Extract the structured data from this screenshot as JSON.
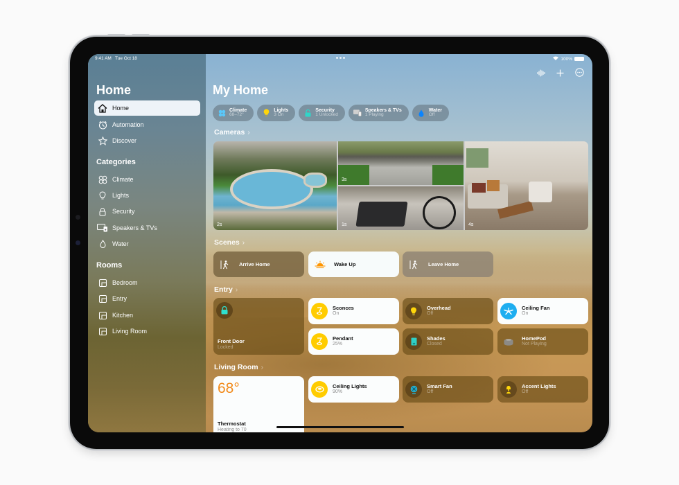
{
  "status_bar": {
    "time": "9:41 AM",
    "date": "Tue Oct 18",
    "battery": "100%"
  },
  "sidebar": {
    "title": "Home",
    "items": [
      {
        "label": "Home",
        "icon": "house-icon",
        "active": true
      },
      {
        "label": "Automation",
        "icon": "clock-icon"
      },
      {
        "label": "Discover",
        "icon": "star-icon"
      }
    ],
    "categories_title": "Categories",
    "categories": [
      {
        "label": "Climate",
        "icon": "fan-icon"
      },
      {
        "label": "Lights",
        "icon": "lightbulb-icon"
      },
      {
        "label": "Security",
        "icon": "lock-icon"
      },
      {
        "label": "Speakers & TVs",
        "icon": "tv-speaker-icon"
      },
      {
        "label": "Water",
        "icon": "drop-icon"
      }
    ],
    "rooms_title": "Rooms",
    "rooms": [
      {
        "label": "Bedroom",
        "icon": "room-icon"
      },
      {
        "label": "Entry",
        "icon": "room-icon"
      },
      {
        "label": "Kitchen",
        "icon": "room-icon"
      },
      {
        "label": "Living Room",
        "icon": "room-icon"
      }
    ]
  },
  "main": {
    "title": "My Home",
    "toolbar": [
      "waveform-icon",
      "plus-icon",
      "more-icon"
    ],
    "chips": [
      {
        "label": "Climate",
        "sub": "68–72°",
        "icon": "fan-icon",
        "color": "#5ac8fa"
      },
      {
        "label": "Lights",
        "sub": "3 On",
        "icon": "lightbulb-icon",
        "color": "#ffd60a"
      },
      {
        "label": "Security",
        "sub": "1 Unlocked",
        "icon": "lock-icon",
        "color": "#30d5c8"
      },
      {
        "label": "Speakers & TVs",
        "sub": "1 Playing",
        "icon": "tv-speaker-icon",
        "color": "#d8d8d8"
      },
      {
        "label": "Water",
        "sub": "Off",
        "icon": "drop-icon",
        "color": "#0a84ff"
      }
    ],
    "cameras": {
      "title": "Cameras",
      "feeds": [
        {
          "label": "2s",
          "name": "pool"
        },
        {
          "label": "3s",
          "name": "driveway"
        },
        {
          "label": "1s",
          "name": "garage"
        },
        {
          "label": "4s",
          "name": "living-room"
        }
      ]
    },
    "scenes": {
      "title": "Scenes",
      "items": [
        {
          "label": "Arrive Home",
          "icon": "person-arrive-icon",
          "active": false
        },
        {
          "label": "Wake Up",
          "icon": "sunrise-icon",
          "active": true
        },
        {
          "label": "Leave Home",
          "icon": "person-leave-icon",
          "active": false
        }
      ]
    },
    "entry": {
      "title": "Entry",
      "front_door": {
        "name": "Front Door",
        "state": "Locked"
      },
      "tiles": [
        {
          "name": "Sconces",
          "state": "On",
          "active": true
        },
        {
          "name": "Overhead",
          "state": "Off",
          "active": false
        },
        {
          "name": "Ceiling Fan",
          "state": "On",
          "active": true
        },
        {
          "name": "Pendant",
          "state": "25%",
          "active": true
        },
        {
          "name": "Shades",
          "state": "Closed",
          "active": false
        },
        {
          "name": "HomePod",
          "state": "Not Playing",
          "active": false
        }
      ]
    },
    "living_room": {
      "title": "Living Room",
      "thermostat": {
        "temp": "68°",
        "name": "Thermostat",
        "state": "Heating to 70"
      },
      "tiles": [
        {
          "name": "Ceiling Lights",
          "state": "90%",
          "active": true
        },
        {
          "name": "Smart Fan",
          "state": "Off",
          "active": false
        },
        {
          "name": "Accent Lights",
          "state": "Off",
          "active": false
        }
      ]
    }
  }
}
